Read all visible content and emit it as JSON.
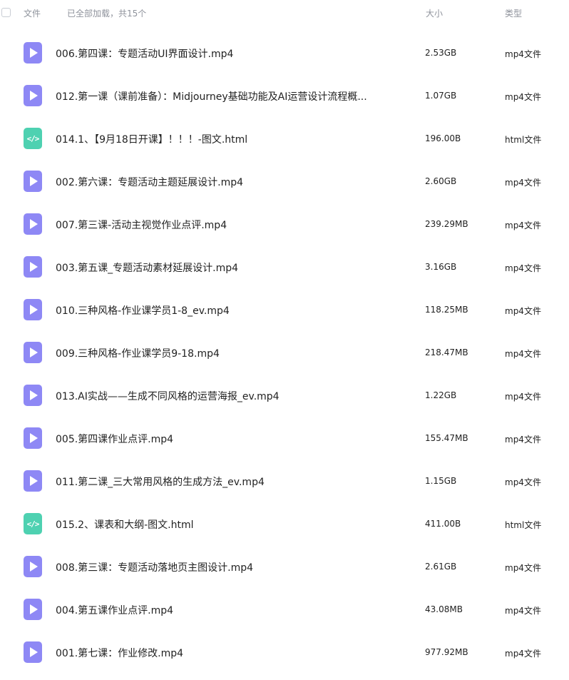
{
  "header": {
    "name_label": "文件",
    "loaded_text": "已全部加载，共15个",
    "size_label": "大小",
    "type_label": "类型"
  },
  "colors": {
    "video_icon": "#8e88f5",
    "html_icon": "#4ed1b1",
    "header_text": "#8f939c"
  },
  "files": [
    {
      "name": "006.第四课：专题活动UI界面设计.mp4",
      "size": "2.53GB",
      "type": "mp4文件",
      "icon": "video-file-icon"
    },
    {
      "name": "012.第一课（课前准备）：Midjourney基础功能及AI运营设计流程概...",
      "size": "1.07GB",
      "type": "mp4文件",
      "icon": "video-file-icon"
    },
    {
      "name": "014.1、【9月18日开课】！！！-图文.html",
      "size": "196.00B",
      "type": "html文件",
      "icon": "code-file-icon"
    },
    {
      "name": "002.第六课：专题活动主题延展设计.mp4",
      "size": "2.60GB",
      "type": "mp4文件",
      "icon": "video-file-icon"
    },
    {
      "name": "007.第三课-活动主视觉作业点评.mp4",
      "size": "239.29MB",
      "type": "mp4文件",
      "icon": "video-file-icon"
    },
    {
      "name": "003.第五课_专题活动素材延展设计.mp4",
      "size": "3.16GB",
      "type": "mp4文件",
      "icon": "video-file-icon"
    },
    {
      "name": "010.三种风格-作业课学员1-8_ev.mp4",
      "size": "118.25MB",
      "type": "mp4文件",
      "icon": "video-file-icon"
    },
    {
      "name": "009.三种风格-作业课学员9-18.mp4",
      "size": "218.47MB",
      "type": "mp4文件",
      "icon": "video-file-icon"
    },
    {
      "name": "013.AI实战——生成不同风格的运营海报_ev.mp4",
      "size": "1.22GB",
      "type": "mp4文件",
      "icon": "video-file-icon"
    },
    {
      "name": "005.第四课作业点评.mp4",
      "size": "155.47MB",
      "type": "mp4文件",
      "icon": "video-file-icon"
    },
    {
      "name": "011.第二课_三大常用风格的生成方法_ev.mp4",
      "size": "1.15GB",
      "type": "mp4文件",
      "icon": "video-file-icon"
    },
    {
      "name": "015.2、课表和大纲-图文.html",
      "size": "411.00B",
      "type": "html文件",
      "icon": "code-file-icon"
    },
    {
      "name": "008.第三课：专题活动落地页主图设计.mp4",
      "size": "2.61GB",
      "type": "mp4文件",
      "icon": "video-file-icon"
    },
    {
      "name": "004.第五课作业点评.mp4",
      "size": "43.08MB",
      "type": "mp4文件",
      "icon": "video-file-icon"
    },
    {
      "name": "001.第七课：作业修改.mp4",
      "size": "977.92MB",
      "type": "mp4文件",
      "icon": "video-file-icon"
    }
  ]
}
